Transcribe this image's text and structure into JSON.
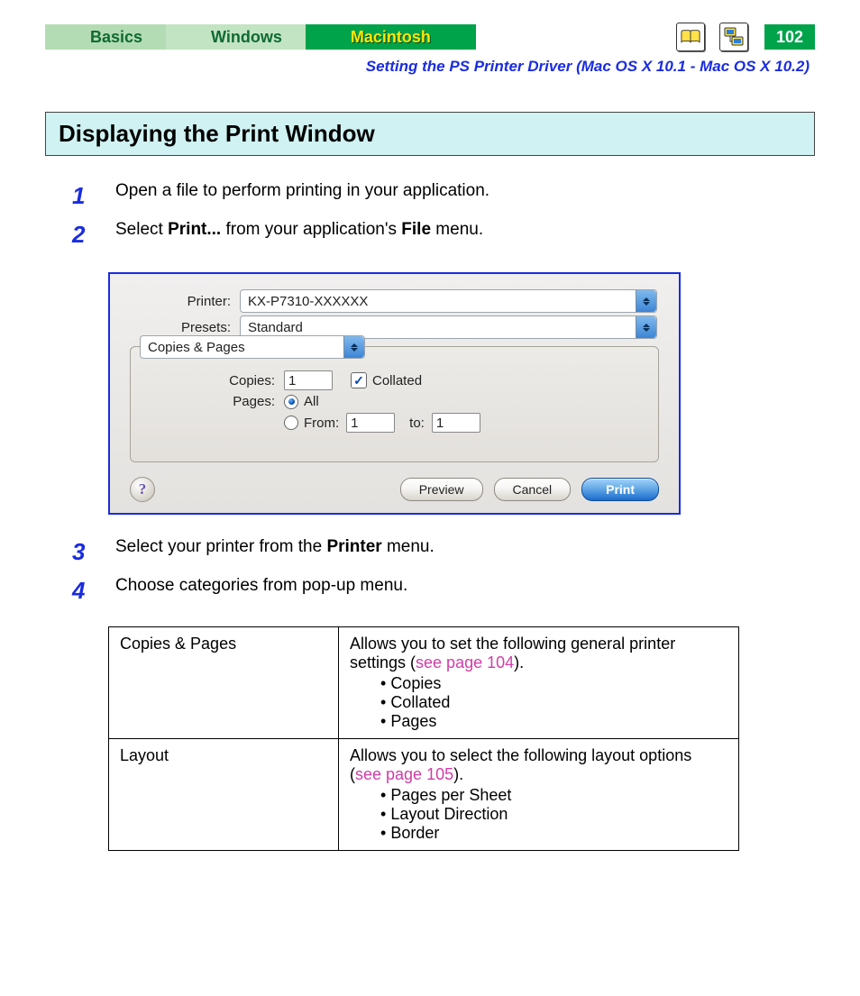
{
  "tabs": {
    "basics": "Basics",
    "windows": "Windows",
    "macintosh": "Macintosh"
  },
  "page_number": "102",
  "subheader": "Setting the PS Printer Driver (Mac OS X 10.1 - Mac OS X 10.2)",
  "section_heading": "Displaying the Print Window",
  "steps": {
    "s1_num": "1",
    "s1_text": "Open a file to perform printing in your application.",
    "s2_num": "2",
    "s2_pre": "Select ",
    "s2_b1": "Print...",
    "s2_mid": " from your application's ",
    "s2_b2": "File",
    "s2_post": " menu.",
    "s3_num": "3",
    "s3_pre": "Select your printer from the ",
    "s3_b": "Printer",
    "s3_post": " menu.",
    "s4_num": "4",
    "s4_text": "Choose categories from pop-up menu."
  },
  "dialog": {
    "printer_label": "Printer:",
    "printer_value": "KX-P7310-XXXXXX",
    "presets_label": "Presets:",
    "presets_value": "Standard",
    "category_value": "Copies & Pages",
    "copies_label": "Copies:",
    "copies_value": "1",
    "collated_label": "Collated",
    "pages_label": "Pages:",
    "pages_all": "All",
    "pages_from": "From:",
    "pages_from_value": "1",
    "pages_to": "to:",
    "pages_to_value": "1",
    "help": "?",
    "preview": "Preview",
    "cancel": "Cancel",
    "print": "Print"
  },
  "table": {
    "r1_name": "Copies & Pages",
    "r1_desc_pre": "Allows you to set the following general printer settings (",
    "r1_link": "see page 104",
    "r1_desc_post": ").",
    "r1_b1": "Copies",
    "r1_b2": "Collated",
    "r1_b3": "Pages",
    "r2_name": "Layout",
    "r2_desc_pre": "Allows you to select the following layout options (",
    "r2_link": "see page 105",
    "r2_desc_post": ").",
    "r2_b1": "Pages per Sheet",
    "r2_b2": "Layout Direction",
    "r2_b3": "Border"
  }
}
